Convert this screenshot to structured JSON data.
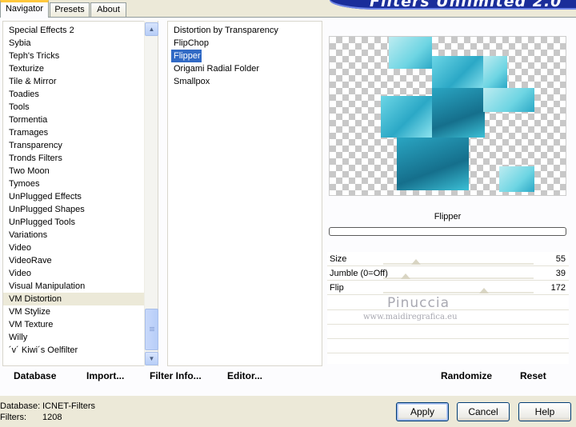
{
  "window": {
    "banner_title": "Filters Unlimited 2.0"
  },
  "tabs": [
    {
      "label": "Navigator",
      "active": true
    },
    {
      "label": "Presets",
      "active": false
    },
    {
      "label": "About",
      "active": false
    }
  ],
  "categories": {
    "items": [
      "Special Effects 2",
      "Sybia",
      "Teph's Tricks",
      "Texturize",
      "Tile & Mirror",
      "Toadies",
      "Tools",
      "Tormentia",
      "Tramages",
      "Transparency",
      "Tronds Filters",
      "Two Moon",
      "Tymoes",
      "UnPlugged Effects",
      "UnPlugged Shapes",
      "UnPlugged Tools",
      "Variations",
      "Video",
      "VideoRave",
      "Video",
      "Visual Manipulation",
      "VM Distortion",
      "VM Stylize",
      "VM Texture",
      "Willy",
      "´v´ Kiwi´s Oelfilter"
    ],
    "selected_index": 21
  },
  "filters": {
    "items": [
      "Distortion by Transparency",
      "FlipChop",
      "Flipper",
      "Origami Radial Folder",
      "Smallpox"
    ],
    "selected_index": 2
  },
  "preview": {
    "filter_name": "Flipper"
  },
  "params": [
    {
      "label": "Size",
      "value": "55",
      "fraction": 0.22
    },
    {
      "label": "Jumble (0=Off)",
      "value": "39",
      "fraction": 0.15
    },
    {
      "label": "Flip",
      "value": "172",
      "fraction": 0.67
    }
  ],
  "watermark": {
    "line1": "Pinuccia",
    "line2": "www.maidiregrafica.eu"
  },
  "panel_buttons": {
    "database": "Database",
    "import": "Import...",
    "filter_info": "Filter Info...",
    "editor": "Editor...",
    "randomize": "Randomize",
    "reset": "Reset"
  },
  "status": {
    "database_label": "Database:",
    "database_value": "ICNET-Filters",
    "filters_label": "Filters:",
    "filters_value": "1208"
  },
  "dialog_buttons": {
    "apply": "Apply",
    "cancel": "Cancel",
    "help": "Help"
  }
}
